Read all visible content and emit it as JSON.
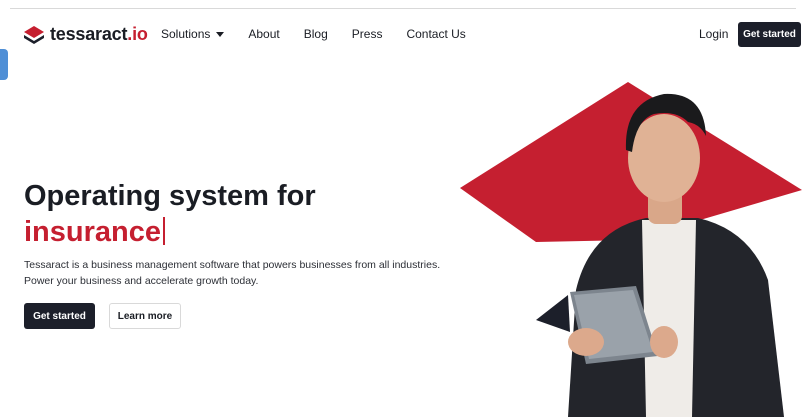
{
  "brand": {
    "name_main": "tessaract",
    "name_accent": ".io",
    "accent_color": "#c51f30",
    "dark_color": "#1c1f2a"
  },
  "nav": {
    "items": [
      {
        "label": "Solutions",
        "has_dropdown": true
      },
      {
        "label": "About"
      },
      {
        "label": "Blog"
      },
      {
        "label": "Press"
      },
      {
        "label": "Contact Us"
      }
    ],
    "login_label": "Login",
    "cta_label": "Get started"
  },
  "hero": {
    "title_line1": "Operating system for",
    "title_line2": "insurance",
    "description_line1": "Tessaract is a business management software that powers businesses from all industries.",
    "description_line2": "Power your business and accelerate growth today.",
    "primary_cta": "Get started",
    "secondary_cta": "Learn more"
  },
  "icons": {
    "logo": "tessaract-logo-icon",
    "dropdown": "caret-down-icon"
  },
  "image": {
    "subject": "man holding tablet over red diamond shape"
  }
}
